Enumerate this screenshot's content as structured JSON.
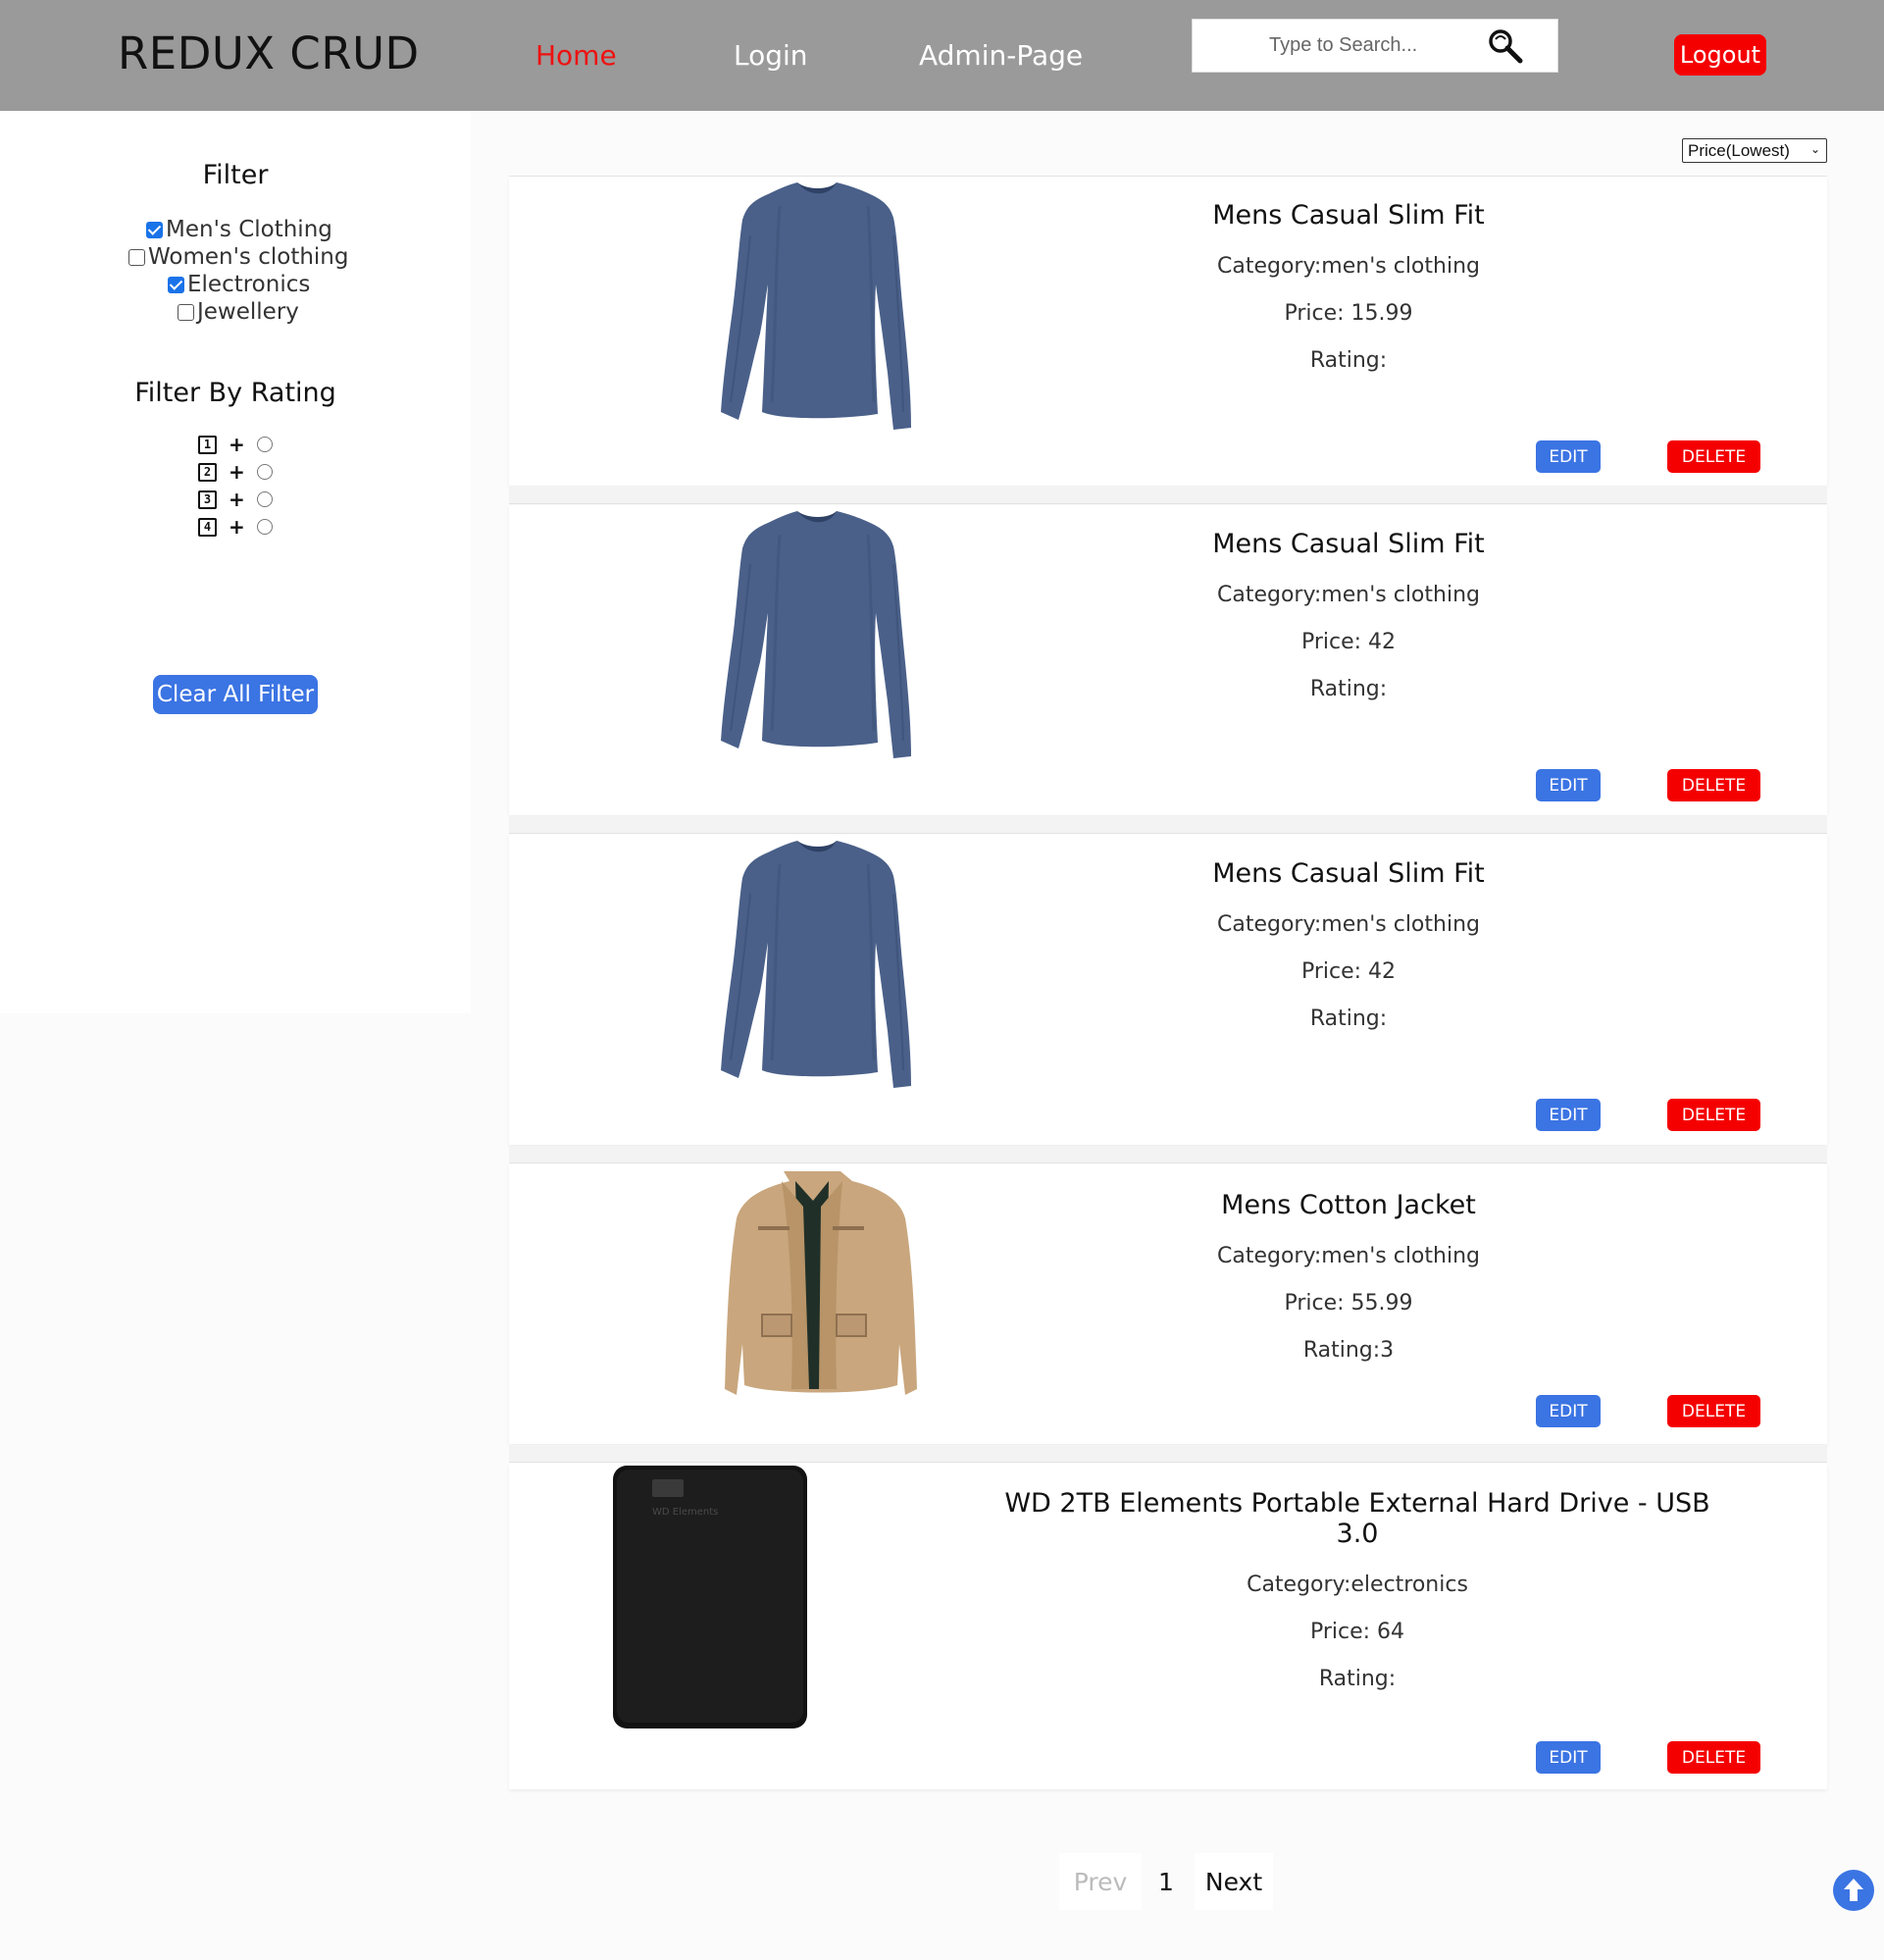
{
  "navbar": {
    "brand": "REDUX CRUD",
    "links": [
      "Home",
      "Login",
      "Admin-Page"
    ],
    "active_link": "Home",
    "search_placeholder": "Type to Search...",
    "logout_label": "Logout",
    "active_color": "#ee1111",
    "bg_color": "#9a9a9a"
  },
  "sidebar": {
    "filter_title": "Filter",
    "categories": [
      {
        "label": "Men's Clothing",
        "checked": true
      },
      {
        "label": "Women's clothing",
        "checked": false
      },
      {
        "label": "Electronics",
        "checked": true
      },
      {
        "label": "Jewellery",
        "checked": false
      }
    ],
    "rating_title": "Filter By Rating",
    "ratings": [
      "1",
      "2",
      "3",
      "4"
    ],
    "rating_plus": "+",
    "clear_label": "Clear All Filter"
  },
  "sort": {
    "selected": "Price(Lowest)"
  },
  "products": [
    {
      "title": "Mens Casual Slim Fit",
      "category": "Category:men's clothing",
      "price": "Price: 15.99",
      "rating": "Rating:",
      "image": "blue-longsleeve-shirt"
    },
    {
      "title": "Mens Casual Slim Fit",
      "category": "Category:men's clothing",
      "price": "Price: 42",
      "rating": "Rating:",
      "image": "blue-longsleeve-shirt"
    },
    {
      "title": "Mens Casual Slim Fit",
      "category": "Category:men's clothing",
      "price": "Price: 42",
      "rating": "Rating:",
      "image": "blue-longsleeve-shirt"
    },
    {
      "title": "Mens Cotton Jacket",
      "category": "Category:men's clothing",
      "price": "Price: 55.99",
      "rating": "Rating:3",
      "image": "beige-cotton-jacket"
    },
    {
      "title": "WD 2TB Elements Portable External Hard Drive - USB 3.0",
      "category": "Category:electronics",
      "price": "Price: 64",
      "rating": "Rating:",
      "image": "black-external-hard-drive",
      "drive_logo": "WD Elements"
    }
  ],
  "buttons": {
    "edit": "EDIT",
    "delete": "DELETE"
  },
  "pagination": {
    "prev": "Prev",
    "current": "1",
    "next": "Next"
  },
  "icons": {
    "search": "search-icon",
    "scroll_top": "arrow-up-circle-icon"
  }
}
